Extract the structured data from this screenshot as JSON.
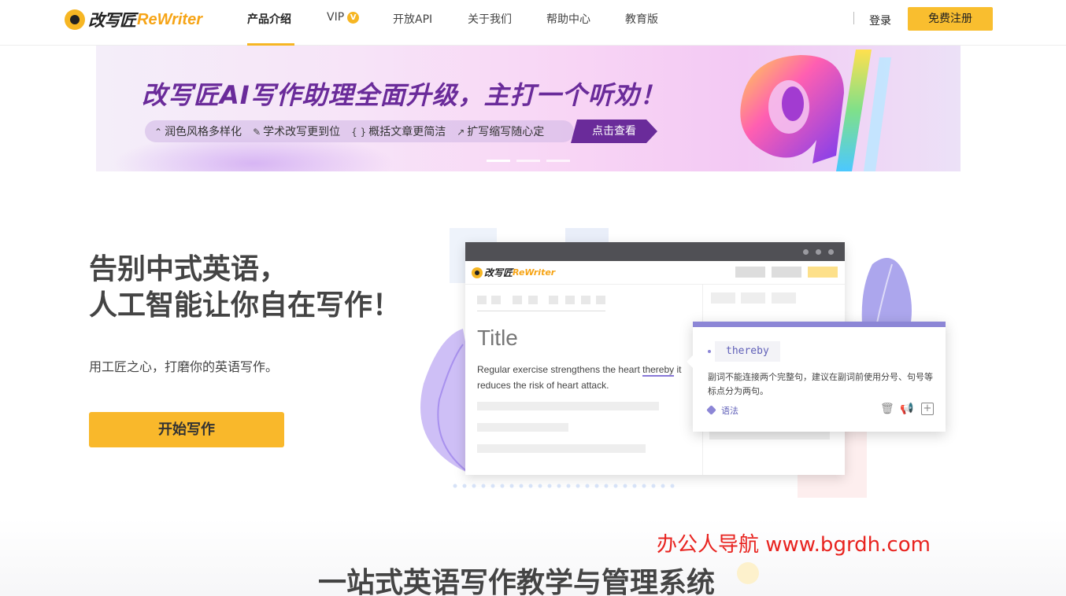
{
  "nav": {
    "logo_cn": "改写匠",
    "logo_en": "ReWriter",
    "items": [
      {
        "label": "产品介绍",
        "active": true
      },
      {
        "label": "VIP",
        "badge": "V"
      },
      {
        "label": "开放API"
      },
      {
        "label": "关于我们"
      },
      {
        "label": "帮助中心"
      },
      {
        "label": "教育版"
      }
    ],
    "login": "登录",
    "register": "免费注册"
  },
  "banner": {
    "headline": "改写匠AI写作助理全面升级，主打一个听劝！",
    "features": [
      {
        "icon": "chevrons-up-icon",
        "label": "润色风格多样化"
      },
      {
        "icon": "pen-icon",
        "label": "学术改写更到位"
      },
      {
        "icon": "braces-icon",
        "label": "概括文章更简洁"
      },
      {
        "icon": "expand-icon",
        "label": "扩写缩写随心定"
      }
    ],
    "cta": "点击查看",
    "active_slide": 1,
    "slide_count": 3
  },
  "hero": {
    "title_line1": "告别中式英语，",
    "title_line2": "人工智能让你自在写作！",
    "subtitle": "用工匠之心，打磨你的英语写作。",
    "start_button": "开始写作"
  },
  "editor": {
    "logo_cn": "改写匠",
    "logo_en": "ReWriter",
    "doc_title": "Title",
    "text_before": "Regular exercise strengthens the heart ",
    "text_highlight": "thereby",
    "text_after": " it reduces the risk of heart attack."
  },
  "suggestion": {
    "word": "thereby",
    "message": "副词不能连接两个完整句，建议在副词前使用分号、句号等标点分为两句。",
    "tag": "语法",
    "actions": [
      "delete-icon",
      "megaphone-icon",
      "plus-box-icon"
    ]
  },
  "watermark": "办公人导航  www.bgrdh.com",
  "section": {
    "title": "一站式英语写作教学与管理系统"
  },
  "colors": {
    "accent": "#f9b82b",
    "banner_purple": "#6a2b9a",
    "suggestion_purple": "#8c86d6",
    "watermark_red": "#e8231f"
  }
}
